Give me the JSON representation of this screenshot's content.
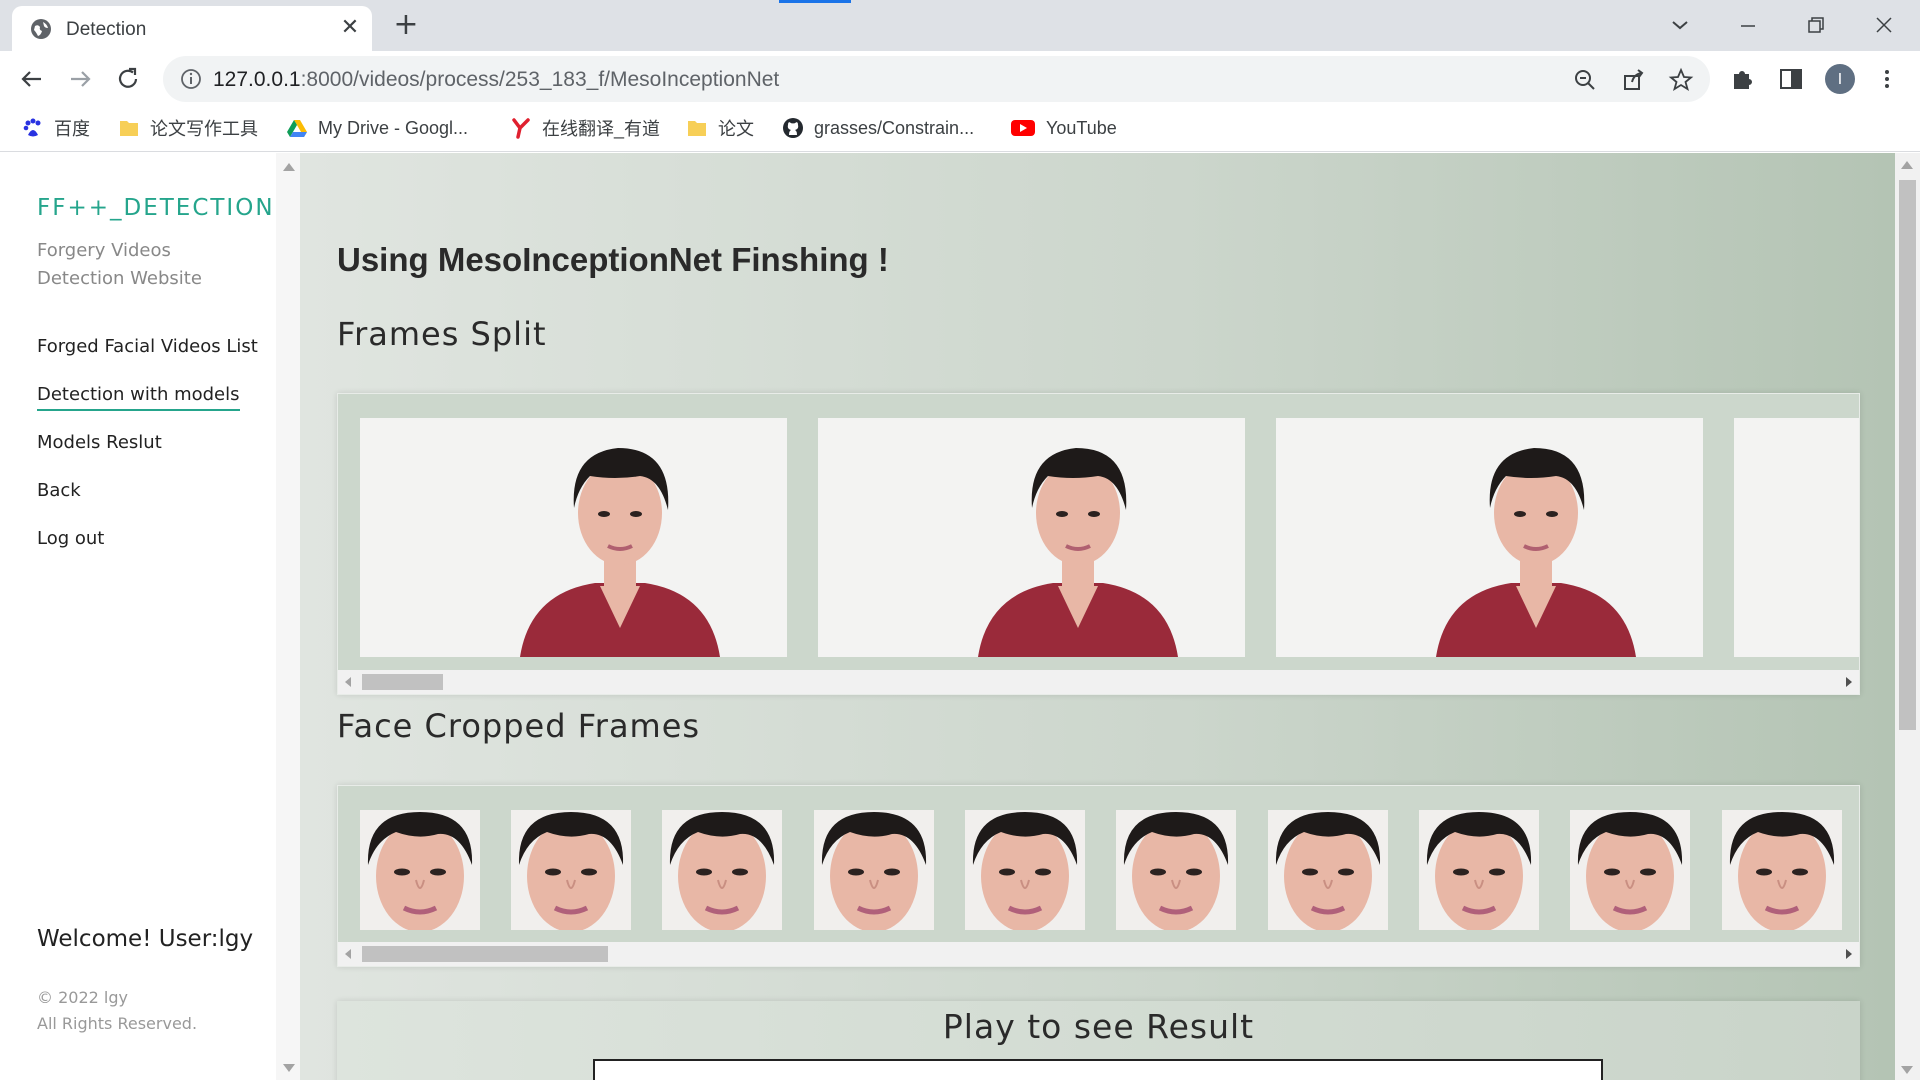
{
  "browser": {
    "tab_title": "Detection",
    "tab_close": "✕",
    "new_tab": "+",
    "url_host": "127.0.0.1",
    "url_rest": ":8000/videos/process/253_183_f/MesoInceptionNet",
    "profile_initial": "I",
    "bookmarks": [
      {
        "label": "百度",
        "icon": "baidu-icon"
      },
      {
        "label": "论文写作工具",
        "icon": "folder-icon"
      },
      {
        "label": "My Drive - Googl...",
        "icon": "google-drive-icon"
      },
      {
        "label": "在线翻译_有道",
        "icon": "youdao-icon"
      },
      {
        "label": "论文",
        "icon": "folder-icon"
      },
      {
        "label": "grasses/Constrain...",
        "icon": "github-icon"
      },
      {
        "label": "YouTube",
        "icon": "youtube-icon"
      }
    ]
  },
  "sidebar": {
    "brand": "FF++_DETECTION",
    "subtitle": "Forgery Videos Detection Website",
    "nav": [
      {
        "label": "Forged Facial Videos List",
        "active": false
      },
      {
        "label": "Detection with models",
        "active": true
      },
      {
        "label": "Models Reslut",
        "active": false
      },
      {
        "label": "Back",
        "active": false
      },
      {
        "label": "Log out",
        "active": false
      }
    ],
    "welcome": "Welcome! User:lgy",
    "copyright_line1": "© 2022 lgy",
    "copyright_line2": "All Rights Reserved."
  },
  "main": {
    "title": "Using MesoInceptionNet Finshing !",
    "frames_heading": "Frames Split",
    "faces_heading": "Face Cropped Frames",
    "result_heading": "Play to see Result",
    "frames_scroll_fraction": 0.05,
    "faces_scroll_fraction": 0.14
  },
  "colors": {
    "accent": "#25a58c",
    "shirt": "#9a2a3a",
    "hair": "#1e1a19",
    "skin": "#e8b7a6"
  }
}
